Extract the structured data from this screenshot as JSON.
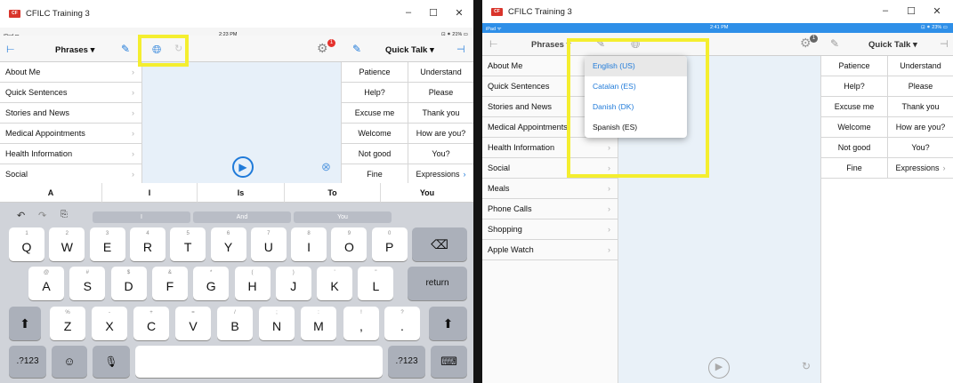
{
  "left": {
    "title": "CFILC Training 3",
    "status": {
      "left": "iPad ᯤ",
      "time": "2:23 PM",
      "right": "⊡ ⁕ 21% ▭"
    },
    "nav": {
      "title": "Phrases ▾",
      "right_title": "Quick Talk ▾",
      "badge": "1"
    },
    "list": [
      "About Me",
      "Quick Sentences",
      "Stories and News",
      "Medical Appointments",
      "Health Information",
      "Social"
    ],
    "quick": [
      [
        "Patience",
        "Understand"
      ],
      [
        "Help?",
        "Please"
      ],
      [
        "Excuse me",
        "Thank you"
      ],
      [
        "Welcome",
        "How are you?"
      ],
      [
        "Not good",
        "You?"
      ],
      [
        "Fine",
        "Expressions"
      ]
    ],
    "predictions": [
      "A",
      "I",
      "Is",
      "To",
      "You"
    ],
    "suggestions": [
      "I",
      "And",
      "You"
    ],
    "keys_row1": [
      [
        "1",
        "Q"
      ],
      [
        "2",
        "W"
      ],
      [
        "3",
        "E"
      ],
      [
        "4",
        "R"
      ],
      [
        "5",
        "T"
      ],
      [
        "6",
        "Y"
      ],
      [
        "7",
        "U"
      ],
      [
        "8",
        "I"
      ],
      [
        "9",
        "O"
      ],
      [
        "0",
        "P"
      ]
    ],
    "keys_row2": [
      [
        "@",
        "A"
      ],
      [
        "#",
        "S"
      ],
      [
        "$",
        "D"
      ],
      [
        "&",
        "F"
      ],
      [
        "*",
        "G"
      ],
      [
        "(",
        "H"
      ],
      [
        ")",
        "J"
      ],
      [
        "'",
        "K"
      ],
      [
        "\"",
        "L"
      ]
    ],
    "keys_row3": [
      [
        "%",
        "Z"
      ],
      [
        "-",
        "X"
      ],
      [
        "+",
        "C"
      ],
      [
        "=",
        "V"
      ],
      [
        "/",
        "B"
      ],
      [
        ";",
        "N"
      ],
      [
        ":",
        "M"
      ]
    ],
    "keys_row3_extra": [
      [
        "!",
        ","
      ],
      [
        "?",
        "."
      ]
    ],
    "return_label": "return",
    "num_label": ".?123",
    "colors": {
      "accent": "#1f7ad9",
      "highlight": "#f4ee2f",
      "badge": "#e5322d"
    }
  },
  "right": {
    "title": "CFILC Training 3",
    "status": {
      "left": "iPad ᯤ",
      "time": "2:41 PM",
      "right": "⊡ ⁕ 23% ▭"
    },
    "nav": {
      "title": "Phrases ▾",
      "right_title": "Quick Talk ▾",
      "badge": "1"
    },
    "list": [
      "About Me",
      "Quick Sentences",
      "Stories and News",
      "Medical Appointments",
      "Health Information",
      "Social",
      "Meals",
      "Phone Calls",
      "Shopping",
      "Apple Watch"
    ],
    "quick": [
      [
        "Patience",
        "Understand"
      ],
      [
        "Help?",
        "Please"
      ],
      [
        "Excuse me",
        "Thank you"
      ],
      [
        "Welcome",
        "How are you?"
      ],
      [
        "Not good",
        "You?"
      ],
      [
        "Fine",
        "Expressions"
      ]
    ],
    "languages": [
      "English (US)",
      "Catalan (ES)",
      "Danish (DK)",
      "Spanish (ES)"
    ]
  }
}
